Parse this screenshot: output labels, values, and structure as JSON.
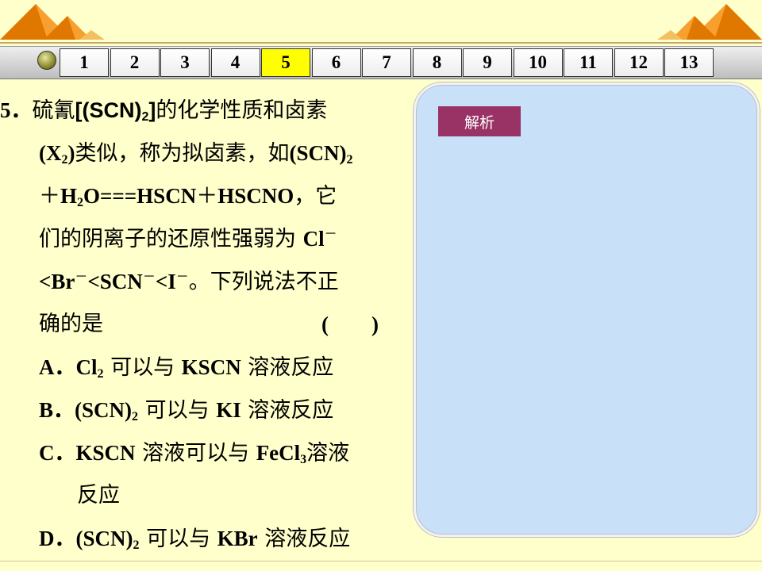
{
  "colors": {
    "background": "#FFFFCC",
    "active_page": "#FFFF00",
    "analysis_button": "#993366",
    "analysis_panel": "#C8E0F8",
    "decoration_orange": "#E07800"
  },
  "nav": {
    "pages": [
      "1",
      "2",
      "3",
      "4",
      "5",
      "6",
      "7",
      "8",
      "9",
      "10",
      "11",
      "12",
      "13"
    ],
    "active": "5"
  },
  "question": {
    "number": "5．",
    "l1_a": "硫氰",
    "l1_f": "[(SCN)",
    "l1_sub": "2",
    "l1_f2": "]",
    "l1_b": "的化学性质和卤素",
    "l2_a": "(X",
    "l2_sub": "2",
    "l2_b": ")",
    "l2_c": "类似，称为拟卤素，如",
    "l2_d": "(SCN)",
    "l2_sub2": "2",
    "l3_a": "＋",
    "l3_b": "H",
    "l3_sub": "2",
    "l3_c": "O===HSCN",
    "l3_d": "＋",
    "l3_e": "HSCNO",
    "l3_f": "，它",
    "l4_a": "们的阴离子的还原性强弱为 ",
    "l4_b": "Cl",
    "l4_sup": "－",
    "l5_a": "<Br",
    "l5_sup1": "－",
    "l5_b": "<SCN",
    "l5_sup2": "－",
    "l5_c": "<I",
    "l5_sup3": "－",
    "l5_d": "。下列说法不正",
    "l6_a": "确的是",
    "l6_paren": "(　　)"
  },
  "options": {
    "A": {
      "label": "A．",
      "f1": "Cl",
      "sub": "2",
      "text": " 可以与 ",
      "f2": "KSCN",
      "text2": " 溶液反应"
    },
    "B": {
      "label": "B．",
      "f1": "(SCN)",
      "sub": "2",
      "text": " 可以与 ",
      "f2": "KI",
      "text2": " 溶液反应"
    },
    "C": {
      "label": "C．",
      "f1": "KSCN",
      "text": " 溶液可以与 ",
      "f2": "FeCl",
      "sub": "3",
      "text2": "溶液",
      "text3": "反应"
    },
    "D": {
      "label": "D．",
      "f1": "(SCN)",
      "sub": "2",
      "text": " 可以与 ",
      "f2": "KBr",
      "text2": " 溶液反应"
    }
  },
  "analysis": {
    "button_label": "解析"
  }
}
